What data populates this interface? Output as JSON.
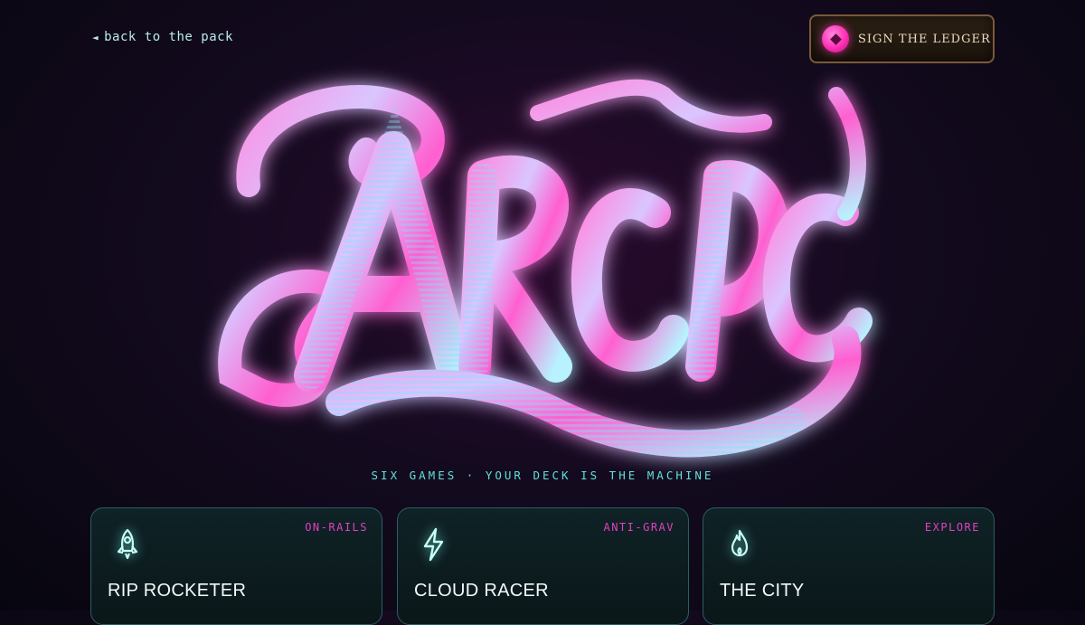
{
  "nav": {
    "back_arrow": "◄",
    "back_label": "back to the pack"
  },
  "ledger_button": {
    "label": "SIGN THE LEDGER",
    "icon": "gem-icon",
    "accent": "#ff2fb3"
  },
  "logo": {
    "text": "ARCADE",
    "colors": [
      "#ff6fd8",
      "#c8f0ff",
      "#5fe0d8"
    ]
  },
  "tagline": "SIX GAMES · YOUR DECK IS THE MACHINE",
  "cards": [
    {
      "tag": "ON-RAILS",
      "title": "RIP ROCKETER",
      "icon": "rocket-icon"
    },
    {
      "tag": "ANTI-GRAV",
      "title": "CLOUD RACER",
      "icon": "lightning-icon"
    },
    {
      "tag": "EXPLORE",
      "title": "THE CITY",
      "icon": "flame-icon"
    }
  ],
  "colors": {
    "tag": "#e23fc2",
    "tagline": "#5fe0d8",
    "card_border": "#2b5f63"
  }
}
